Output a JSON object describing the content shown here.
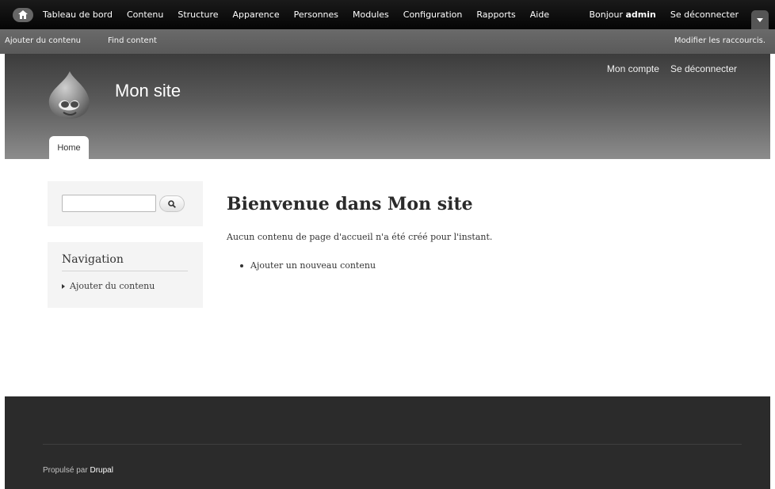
{
  "toolbar": {
    "menu": [
      "Tableau de bord",
      "Contenu",
      "Structure",
      "Apparence",
      "Personnes",
      "Modules",
      "Configuration",
      "Rapports",
      "Aide"
    ],
    "greeting": "Bonjour ",
    "username": "admin",
    "logout": "Se déconnecter",
    "icons": {
      "home": "home-icon",
      "drawer": "chevron-down-icon"
    }
  },
  "shortcuts": {
    "items": [
      "Ajouter du contenu",
      "Find content"
    ],
    "edit": "Modifier les raccourcis."
  },
  "header": {
    "site_name": "Mon site",
    "secondary_menu": [
      "Mon compte",
      "Se déconnecter"
    ],
    "tabs": [
      "Home"
    ]
  },
  "sidebar": {
    "search": {
      "value": "",
      "button_icon": "search-icon"
    },
    "navigation": {
      "title": "Navigation",
      "items": [
        "Ajouter du contenu"
      ]
    }
  },
  "content": {
    "title": "Bienvenue dans Mon site",
    "intro": "Aucun contenu de page d'accueil n'a été créé pour l'instant.",
    "links": [
      "Ajouter un nouveau contenu"
    ]
  },
  "footer": {
    "powered_prefix": "Propulsé par ",
    "powered_link": "Drupal"
  },
  "colors": {
    "toolbar_bg": "#0d0d0d",
    "shortcut_bg": "#626262",
    "footer_bg": "#2b2b2b",
    "sidebar_block_bg": "#f4f4f4"
  }
}
